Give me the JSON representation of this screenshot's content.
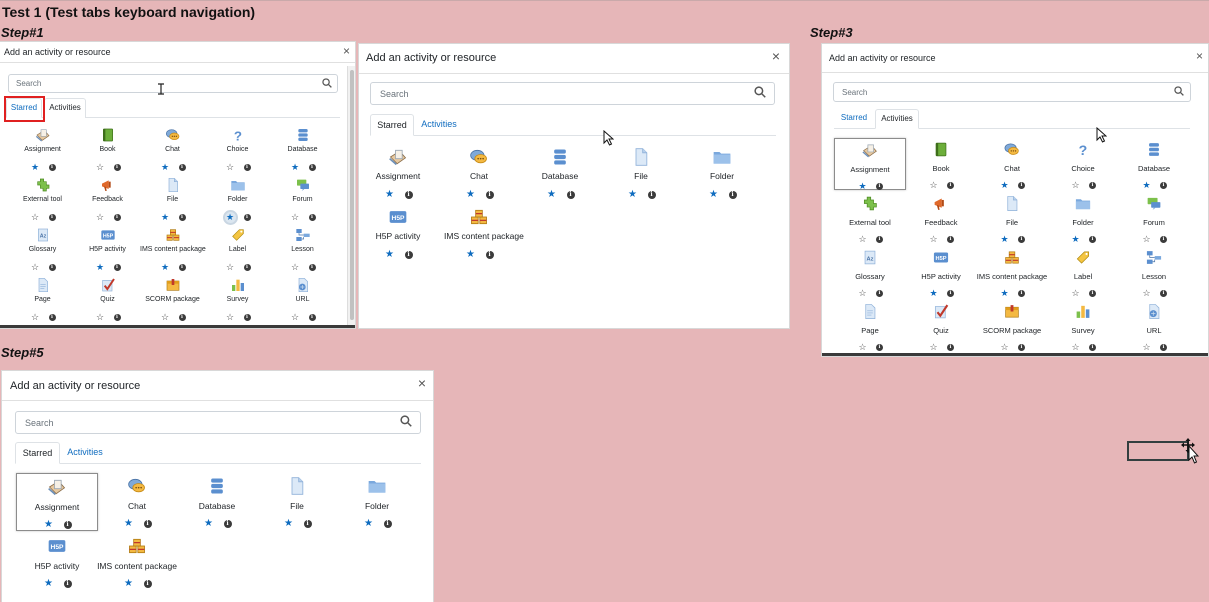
{
  "page": {
    "title": "Test 1 (Test tabs keyboard navigation)",
    "steps": [
      "Step#1",
      "Step#3",
      "Step#5"
    ]
  },
  "dialog": {
    "title": "Add an activity or resource",
    "close": "×",
    "search_placeholder": "Search",
    "tab_starred": "Starred",
    "tab_activities": "Activities"
  },
  "info_glyph": "i",
  "star_on": "★",
  "star_off": "☆",
  "colors": {
    "accent": "#0f6cbf",
    "page_bg": "#e6b6b8",
    "focus_outline": "#e02020"
  },
  "activities": [
    {
      "name": "Assignment",
      "icon": "assignment-icon",
      "starred": true
    },
    {
      "name": "Book",
      "icon": "book-icon",
      "starred": false
    },
    {
      "name": "Chat",
      "icon": "chat-icon",
      "starred": true
    },
    {
      "name": "Choice",
      "icon": "choice-icon",
      "starred": false
    },
    {
      "name": "Database",
      "icon": "database-icon",
      "starred": true
    },
    {
      "name": "External tool",
      "icon": "external-tool-icon",
      "starred": false
    },
    {
      "name": "Feedback",
      "icon": "feedback-icon",
      "starred": false
    },
    {
      "name": "File",
      "icon": "file-icon",
      "starred": true
    },
    {
      "name": "Folder",
      "icon": "folder-icon",
      "starred": true
    },
    {
      "name": "Forum",
      "icon": "forum-icon",
      "starred": false
    },
    {
      "name": "Glossary",
      "icon": "glossary-icon",
      "starred": false
    },
    {
      "name": "H5P activity",
      "icon": "h5p-icon",
      "starred": true
    },
    {
      "name": "IMS content package",
      "icon": "ims-icon",
      "starred": true
    },
    {
      "name": "Label",
      "icon": "label-icon",
      "starred": false
    },
    {
      "name": "Lesson",
      "icon": "lesson-icon",
      "starred": false
    },
    {
      "name": "Page",
      "icon": "page-icon",
      "starred": false
    },
    {
      "name": "Quiz",
      "icon": "quiz-icon",
      "starred": false
    },
    {
      "name": "SCORM package",
      "icon": "scorm-icon",
      "starred": false
    },
    {
      "name": "Survey",
      "icon": "survey-icon",
      "starred": false
    },
    {
      "name": "URL",
      "icon": "url-icon",
      "starred": false
    }
  ],
  "starred_items": [
    {
      "name": "Assignment",
      "icon": "assignment-icon",
      "starred": true
    },
    {
      "name": "Chat",
      "icon": "chat-icon",
      "starred": true
    },
    {
      "name": "Database",
      "icon": "database-icon",
      "starred": true
    },
    {
      "name": "File",
      "icon": "file-icon",
      "starred": true
    },
    {
      "name": "Folder",
      "icon": "folder-icon",
      "starred": true
    },
    {
      "name": "H5P activity",
      "icon": "h5p-icon",
      "starred": true
    },
    {
      "name": "IMS content package",
      "icon": "ims-icon",
      "starred": true
    }
  ]
}
